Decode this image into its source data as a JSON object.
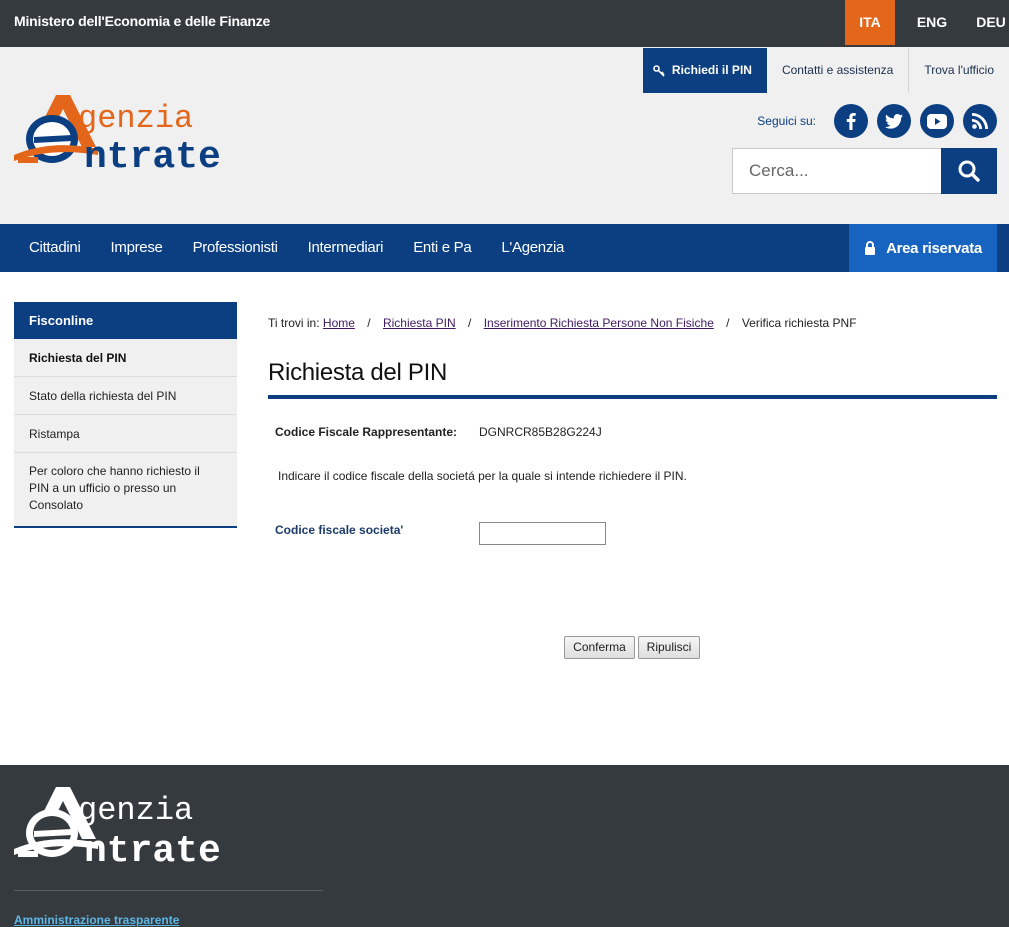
{
  "topbar": {
    "ministry": "Ministero dell'Economia e delle Finanze",
    "languages": [
      "ITA",
      "ENG",
      "DEU"
    ],
    "active_language": "ITA"
  },
  "header": {
    "logo_text_line1": "genzia",
    "logo_text_line2": "ntrate",
    "links": {
      "pin": "Richiedi il PIN",
      "contacts": "Contatti e assistenza",
      "office": "Trova l'ufficio"
    },
    "social_label": "Seguici su:",
    "social_icons": [
      "facebook-icon",
      "twitter-icon",
      "youtube-icon",
      "rss-icon"
    ],
    "search_placeholder": "Cerca..."
  },
  "nav": {
    "items": [
      "Cittadini",
      "Imprese",
      "Professionisti",
      "Intermediari",
      "Enti e Pa",
      "L'Agenzia"
    ],
    "reserved_area": "Area riservata"
  },
  "sidebar": {
    "heading": "Fisconline",
    "items": [
      "Richiesta del PIN",
      "Stato della richiesta del PIN",
      "Ristampa",
      "Per coloro che hanno richiesto il PIN a un ufficio o presso un Consolato"
    ]
  },
  "breadcrumb": {
    "prefix": "Ti trovi in:",
    "links": [
      "Home",
      "Richiesta PIN",
      "Inserimento Richiesta Persone Non Fisiche"
    ],
    "current": "Verifica richiesta PNF",
    "separator": "/"
  },
  "main": {
    "title": "Richiesta del PIN",
    "cf_label": "Codice Fiscale Rappresentante:",
    "cf_value": "DGNRCR85B28G224J",
    "instruction": "Indicare il codice fiscale della societá per la quale si intende richiedere il PIN.",
    "field_label": "Codice fiscale societa'",
    "field_value": "",
    "confirm_button": "Conferma",
    "clear_button": "Ripulisci"
  },
  "footer": {
    "logo_text_line1": "genzia",
    "logo_text_line2": "ntrate",
    "link": "Amministrazione trasparente"
  },
  "colors": {
    "dark_bar": "#353a3f",
    "brand_blue": "#0b3f82",
    "accent_orange": "#e3661a",
    "reserved_blue": "#1764c0"
  }
}
